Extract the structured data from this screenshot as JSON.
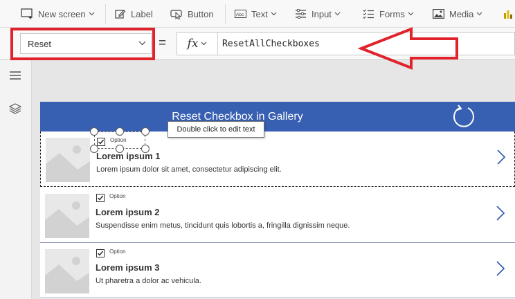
{
  "ribbon": {
    "new_screen": "New screen",
    "label": "Label",
    "button": "Button",
    "text": "Text",
    "input": "Input",
    "forms": "Forms",
    "media": "Media"
  },
  "formula_bar": {
    "property": "Reset",
    "equals": "=",
    "fx": "fx",
    "formula": "ResetAllCheckboxes"
  },
  "gallery": {
    "title": "Reset Checkbox in Gallery",
    "tooltip": "Double click to edit text",
    "items": [
      {
        "option": "Option",
        "title": "Lorem ipsum 1",
        "subtitle": "Lorem ipsum dolor sit amet, consectetur adipiscing elit.",
        "checked": true
      },
      {
        "option": "Option",
        "title": "Lorem ipsum 2",
        "subtitle": "Suspendisse enim metus, tincidunt quis lobortis a, fringilla dignissim neque.",
        "checked": true
      },
      {
        "option": "Option",
        "title": "Lorem ipsum 3",
        "subtitle": "Ut pharetra a dolor ac vehicula.",
        "checked": true
      }
    ]
  },
  "colors": {
    "header": "#3860b2",
    "annotation": "#e0222b",
    "ribbon_bg": "#f8f8f8",
    "canvas_bg": "#e6e6e6"
  },
  "icons": [
    "new-screen-icon",
    "label-icon",
    "button-icon",
    "text-icon",
    "input-icon",
    "forms-icon",
    "media-icon",
    "chart-icon",
    "hamburger-icon",
    "layers-icon",
    "reset-icon",
    "image-placeholder-icon",
    "chevron-right-icon"
  ]
}
